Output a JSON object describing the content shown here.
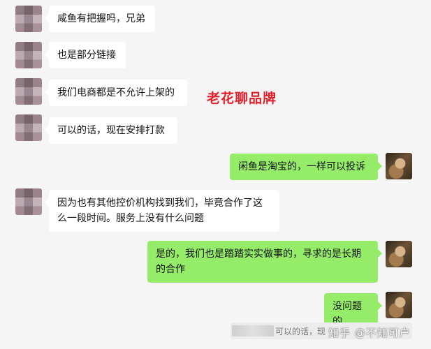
{
  "overlay_title": "老花聊品牌",
  "messages": [
    {
      "side": "left",
      "text": "咸鱼有把握吗，兄弟"
    },
    {
      "side": "left",
      "text": "也是部分链接"
    },
    {
      "side": "left",
      "text": "我们电商都是不允许上架的"
    },
    {
      "side": "left",
      "text": "可以的话，现在安排打款"
    },
    {
      "side": "right",
      "text": "闲鱼是淘宝的，一样可以投诉"
    },
    {
      "side": "left",
      "text": "因为也有其他控价机构找到我们，毕竟合作了这么一段时间。服务上没有什么问题"
    },
    {
      "side": "right",
      "text": "是的，我们也是踏踏实实做事的，寻求的是长期的合作"
    },
    {
      "side": "right",
      "text": "没问题的"
    }
  ],
  "partial_message": "可以的话，现",
  "watermark": "知乎 @不知可户"
}
